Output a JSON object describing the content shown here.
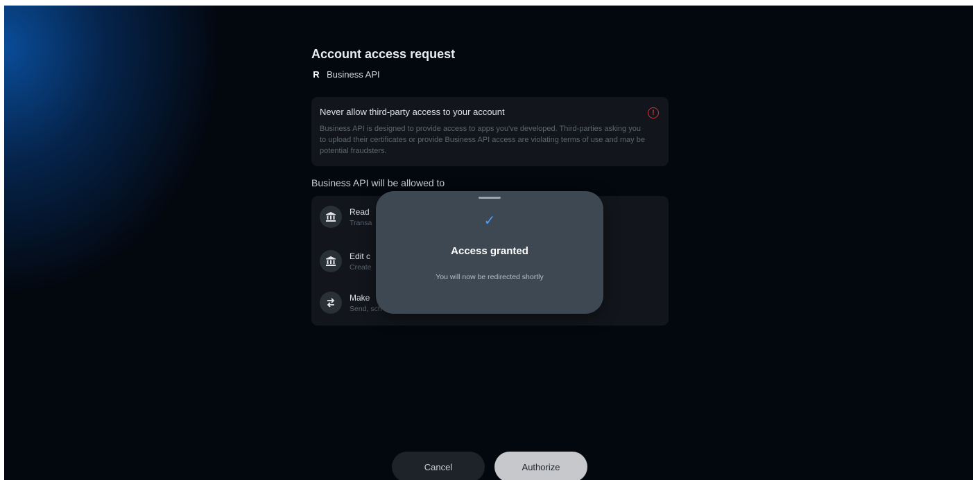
{
  "page": {
    "title": "Account access request",
    "app_logo": "R",
    "app_name": "Business API"
  },
  "warning": {
    "title": "Never allow third-party access to your account",
    "body": "Business API is designed to provide access to apps you've developed. Third-parties asking you to upload their certificates or provide Business API access are violating terms of use and may be potential fraudsters.",
    "icon": "alert-circle-icon",
    "icon_color": "#d0333b"
  },
  "permissions": {
    "heading": "Business API will be allowed to",
    "items": [
      {
        "icon": "bank-icon",
        "glyph": "🏛",
        "title": "Read",
        "subtitle": "Transa"
      },
      {
        "icon": "bank-icon",
        "glyph": "🏛",
        "title": "Edit c",
        "subtitle": "Create"
      },
      {
        "icon": "transfer-arrows-icon",
        "glyph": "⇄",
        "title": "Make",
        "subtitle": "Send, sch"
      }
    ]
  },
  "modal": {
    "check_glyph": "✓",
    "title": "Access granted",
    "subtitle": "You will now be redirected shortly",
    "accent": "#4b9bff"
  },
  "actions": {
    "cancel_label": "Cancel",
    "authorize_label": "Authorize"
  }
}
